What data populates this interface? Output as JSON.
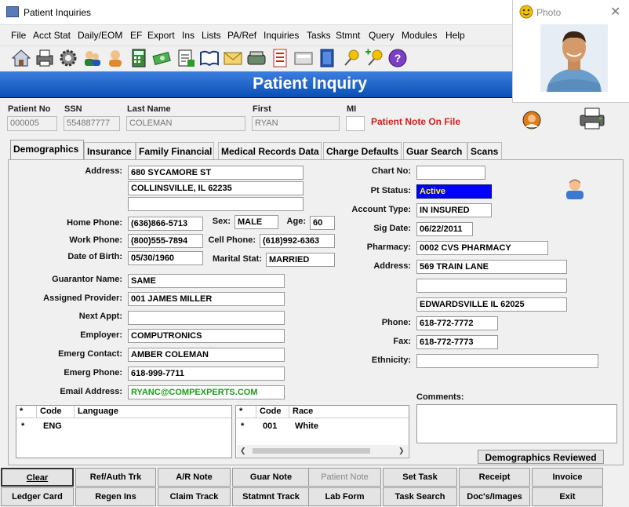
{
  "window": {
    "title": "Patient Inquiries"
  },
  "menu": [
    "File",
    "Acct Stat",
    "Daily/EOM",
    "EF",
    "Export",
    "Ins",
    "Lists",
    "PA/Ref",
    "Inquiries",
    "Tasks",
    "Stmnt",
    "Query",
    "Modules",
    "Help"
  ],
  "toolbar_icons": [
    "home-icon",
    "printer-icon",
    "gear-icon",
    "users-icon",
    "person-icon",
    "calculator-icon",
    "money-icon",
    "form-icon",
    "book-icon",
    "envelope-icon",
    "scanner-icon",
    "document-icon",
    "fax-icon",
    "address-book-icon",
    "pin-icon",
    "pin-add-icon",
    "help-icon"
  ],
  "photo_window": {
    "title": "Photo"
  },
  "banner": {
    "title": "Patient Inquiry"
  },
  "header": {
    "patient_no_label": "Patient No",
    "patient_no": "000005",
    "ssn_label": "SSN",
    "ssn": "554887777",
    "last_name_label": "Last Name",
    "last_name": "COLEMAN",
    "first_label": "First",
    "first": "RYAN",
    "mi_label": "MI",
    "mi": "",
    "patient_note": "Patient Note On File"
  },
  "tabs": [
    "Demographics",
    "Insurance",
    "Family Financial",
    "Medical Records Data",
    "Charge Defaults",
    "Guar Search",
    "Scans"
  ],
  "demo": {
    "address_label": "Address:",
    "address1": "680 SYCAMORE ST",
    "address2": "COLLINSVILLE, IL 62235",
    "address3": "",
    "home_phone_label": "Home Phone:",
    "home_phone": "(636)866-5713",
    "sex_label": "Sex:",
    "sex": "MALE",
    "age_label": "Age:",
    "age": "60",
    "work_phone_label": "Work Phone:",
    "work_phone": "(800)555-7894",
    "cell_phone_label": "Cell Phone:",
    "cell_phone": "(618)992-6363",
    "dob_label": "Date of Birth:",
    "dob": "05/30/1960",
    "marital_label": "Marital Stat:",
    "marital": "MARRIED",
    "guarantor_label": "Guarantor Name:",
    "guarantor": "SAME",
    "provider_label": "Assigned Provider:",
    "provider": "001 JAMES  MILLER",
    "next_appt_label": "Next Appt:",
    "next_appt": "",
    "employer_label": "Employer:",
    "employer": "COMPUTRONICS",
    "emerg_contact_label": "Emerg Contact:",
    "emerg_contact": "AMBER COLEMAN",
    "emerg_phone_label": "Emerg Phone:",
    "emerg_phone": "618-999-7711",
    "email_label": "Email Address:",
    "email": "RYANC@COMPEXPERTS.COM",
    "chart_no_label": "Chart No:",
    "chart_no": "",
    "pt_status_label": "Pt Status:",
    "pt_status": "Active",
    "account_type_label": "Account Type:",
    "account_type": "IN INSURED",
    "sig_date_label": "Sig Date:",
    "sig_date": "06/22/2011",
    "pharmacy_label": "Pharmacy:",
    "pharmacy": "0002 CVS PHARMACY",
    "pharm_address_label": "Address:",
    "pharm_address1": "569 TRAIN LANE",
    "pharm_address2": "",
    "pharm_address3": "EDWARDSVILLE IL 62025",
    "phone_label": "Phone:",
    "phone": "618-772-7772",
    "fax_label": "Fax:",
    "fax": "618-772-7773",
    "ethnicity_label": "Ethnicity:",
    "ethnicity": "",
    "comments_label": "Comments:",
    "comments": ""
  },
  "language_grid": {
    "star": "*",
    "code_header": "Code",
    "lang_header": "Language",
    "rows": [
      {
        "star": "*",
        "code": "ENG",
        "lang": ""
      }
    ]
  },
  "race_grid": {
    "star": "*",
    "code_header": "Code",
    "race_header": "Race",
    "rows": [
      {
        "star": "*",
        "code": "001",
        "race": "White"
      }
    ]
  },
  "demographics_reviewed": "Demographics Reviewed",
  "buttons_row1": [
    "Clear",
    "Ref/Auth Trk",
    "A/R Note",
    "Guar Note",
    "Patient Note",
    "Set Task",
    "Receipt",
    "Invoice"
  ],
  "buttons_row2": [
    "Ledger Card",
    "Regen Ins",
    "Claim Track",
    "Statmnt Track",
    "Lab Form",
    "Task Search",
    "Doc's/Images",
    "Exit"
  ],
  "colors": {
    "banner": "#1a5fc8",
    "status_active_bg": "#0000ff",
    "status_active_fg": "#ffff00",
    "email": "#1a9a1a",
    "note_red": "#d81b1b"
  }
}
